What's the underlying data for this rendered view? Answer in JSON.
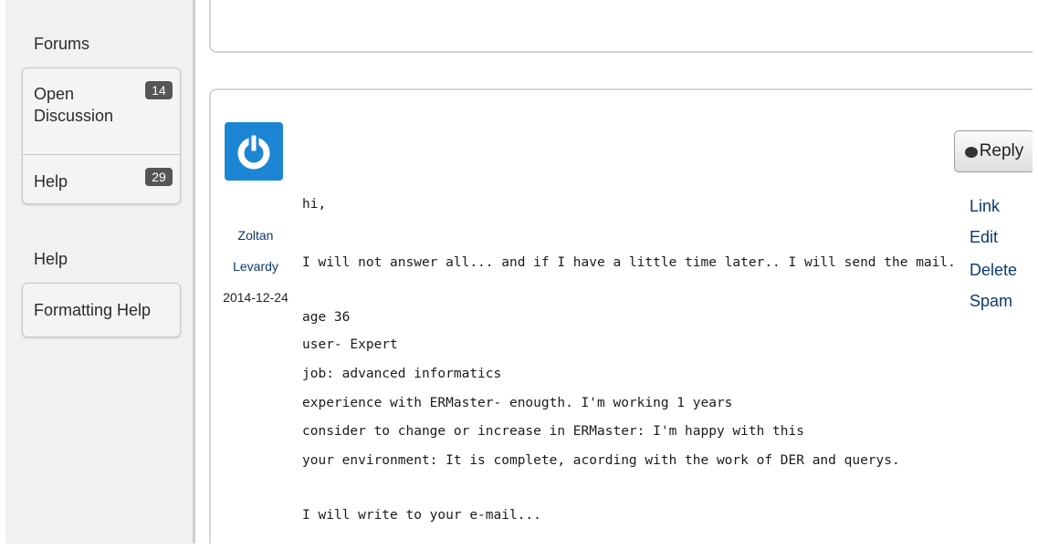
{
  "sidebar": {
    "forums_heading": "Forums",
    "forums": [
      {
        "label_line1": "Open",
        "label_line2": "Discussion",
        "count": "14"
      },
      {
        "label": "Help",
        "count": "29"
      }
    ],
    "help_heading": "Help",
    "help_items": [
      {
        "label": "Formatting Help"
      }
    ]
  },
  "post": {
    "author_first": "Zoltan",
    "author_last": "Levardy",
    "date": "2014-12-24",
    "reply_label": "Reply",
    "actions": [
      "Link",
      "Edit",
      "Delete",
      "Spam"
    ],
    "body": [
      "hi,",
      "I will not answer all... and if I have a little time later.. I will send the mail.",
      "age 36",
      "user- Expert",
      "job: advanced informatics",
      "experience with ERMaster- enougth. I'm working 1 years",
      "consider to change or increase in ERMaster: I'm happy with this",
      "your environment: It is complete, acording with the work of DER and querys.",
      "I will write to your e-mail..."
    ]
  },
  "colors": {
    "avatar_blue": "#1c86d4",
    "link_blue": "#0c3a6e",
    "badge_gray": "#555555",
    "sidebar_bg": "#f1f1f1"
  },
  "icons": {
    "avatar": "power-icon",
    "reply": "speech-bubble-icon"
  }
}
